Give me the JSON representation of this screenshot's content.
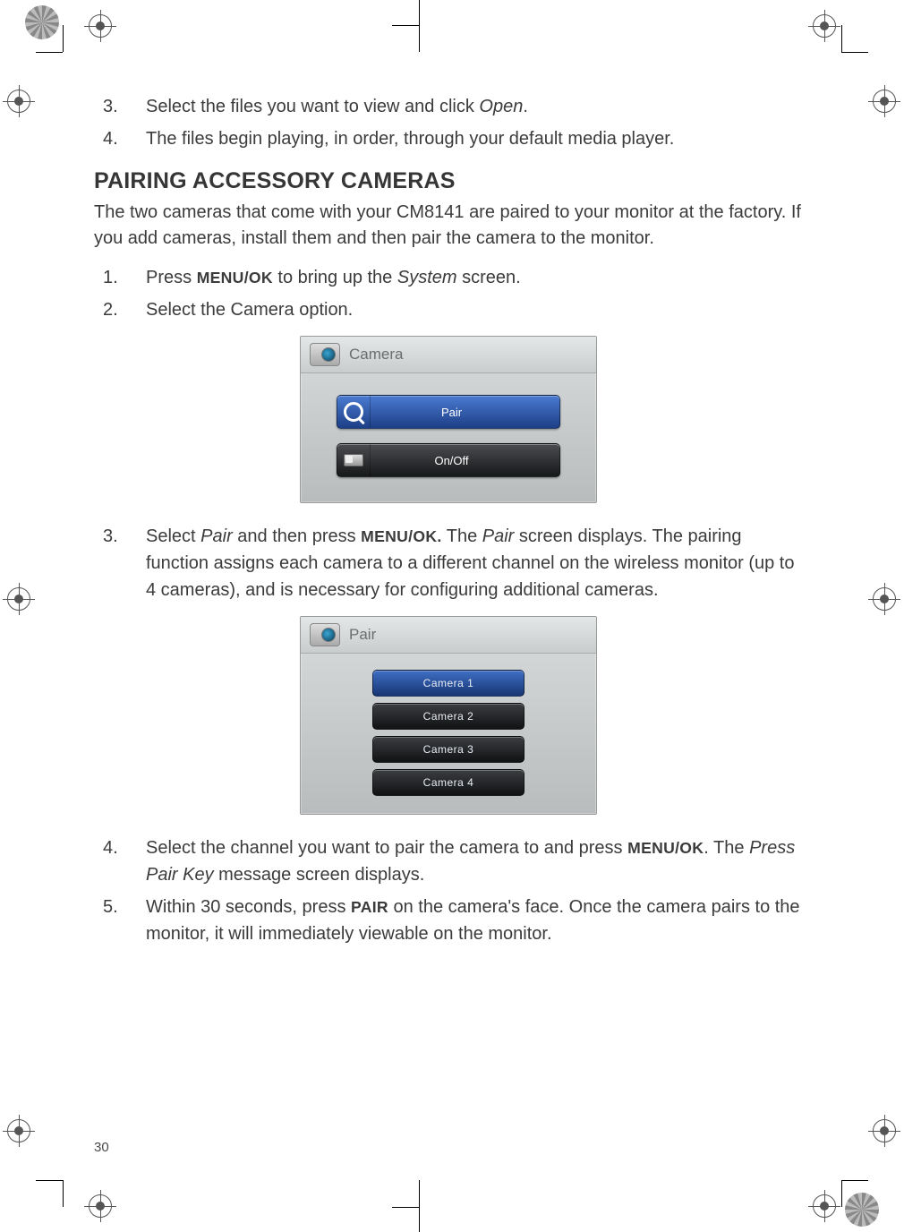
{
  "page_number": "30",
  "top_steps": [
    {
      "n": "3.",
      "pre": "Select the files you want to view and click ",
      "em": "Open",
      "post": "."
    },
    {
      "n": "4.",
      "pre": "The files begin playing, in order, through your default media player.",
      "em": "",
      "post": ""
    }
  ],
  "section_heading": "PAIRING ACCESSORY CAMERAS",
  "intro": "The two cameras that come with your CM8141 are paired to your monitor at the factory. If you add cameras, install them and then pair the camera to the monitor.",
  "steps_a": [
    {
      "n": "1.",
      "parts": [
        {
          "t": "Press "
        },
        {
          "t": "MENU/OK",
          "cls": "boldcap"
        },
        {
          "t": " to bring up the "
        },
        {
          "t": "System",
          "cls": "italic"
        },
        {
          "t": " screen."
        }
      ]
    },
    {
      "n": "2.",
      "parts": [
        {
          "t": "Select the Camera option."
        }
      ]
    }
  ],
  "screenshot1": {
    "title": "Camera",
    "buttons": [
      {
        "label": "Pair",
        "style": "blue",
        "icon": "magnifier"
      },
      {
        "label": "On/Off",
        "style": "dark",
        "icon": "toggle"
      }
    ]
  },
  "steps_b": [
    {
      "n": "3.",
      "parts": [
        {
          "t": "Select "
        },
        {
          "t": "Pair",
          "cls": "italic"
        },
        {
          "t": " and then press "
        },
        {
          "t": "MENU/OK.",
          "cls": "boldcap"
        },
        {
          "t": " The "
        },
        {
          "t": "Pair",
          "cls": "italic"
        },
        {
          "t": " screen displays. The pairing function assigns each camera to a different channel on the wireless monitor (up to 4 cameras), and is necessary for configuring additional cameras."
        }
      ]
    }
  ],
  "screenshot2": {
    "title": "Pair",
    "items": [
      {
        "label": "Camera  1",
        "selected": true
      },
      {
        "label": "Camera  2",
        "selected": false
      },
      {
        "label": "Camera  3",
        "selected": false
      },
      {
        "label": "Camera  4",
        "selected": false
      }
    ]
  },
  "steps_c": [
    {
      "n": "4.",
      "parts": [
        {
          "t": "Select the channel you want to pair the camera to and press "
        },
        {
          "t": "MENU/OK",
          "cls": "boldcap"
        },
        {
          "t": ". The "
        },
        {
          "t": "Press Pair Key",
          "cls": "italic"
        },
        {
          "t": " message screen displays."
        }
      ]
    },
    {
      "n": "5.",
      "parts": [
        {
          "t": "Within 30 seconds, press "
        },
        {
          "t": "PAIR",
          "cls": "boldcap"
        },
        {
          "t": "  on the camera's face. Once the camera pairs to the monitor, it will immediately viewable on the monitor."
        }
      ]
    }
  ]
}
